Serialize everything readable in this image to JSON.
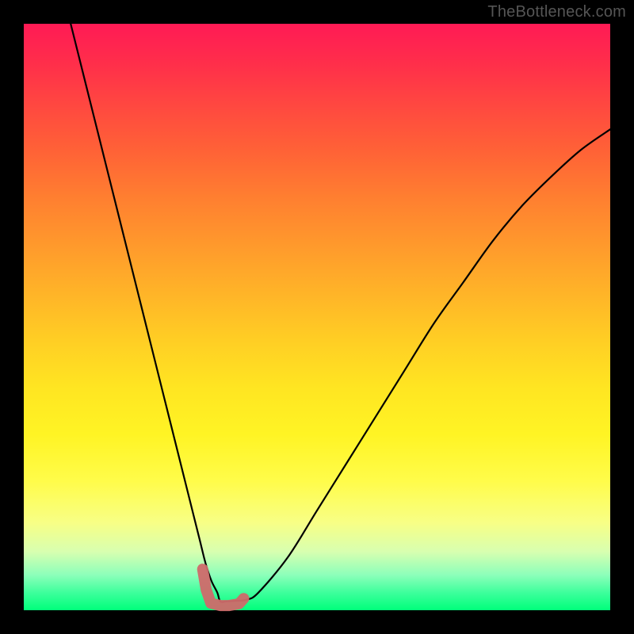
{
  "watermark": "TheBottleneck.com",
  "chart_data": {
    "type": "line",
    "title": "",
    "xlabel": "",
    "ylabel": "",
    "xlim": [
      0,
      100
    ],
    "ylim": [
      0,
      100
    ],
    "series": [
      {
        "name": "bottleneck-curve",
        "x": [
          8,
          10,
          12,
          14,
          16,
          18,
          20,
          22,
          24,
          26,
          28,
          30,
          31,
          32,
          33,
          33.5,
          34.5,
          36,
          38,
          40,
          45,
          50,
          55,
          60,
          65,
          70,
          75,
          80,
          85,
          90,
          95,
          100
        ],
        "values": [
          100,
          92,
          84,
          76,
          68,
          60,
          52,
          44,
          36,
          28,
          20,
          12,
          8,
          5,
          3,
          1.5,
          1.5,
          1.6,
          1.8,
          3,
          9,
          17,
          25,
          33,
          41,
          49,
          56,
          63,
          69,
          74,
          78.5,
          82
        ]
      }
    ],
    "annotations": [
      {
        "name": "operating-range-marker",
        "type": "segment-highlight",
        "x_range": [
          30.5,
          37.5
        ],
        "y_range": [
          0.8,
          7.0
        ],
        "color": "#d46a6a"
      }
    ],
    "background_gradient": {
      "type": "vertical",
      "stops": [
        {
          "pos": 0.0,
          "color": "#ff1a55"
        },
        {
          "pos": 0.3,
          "color": "#ff8030"
        },
        {
          "pos": 0.62,
          "color": "#ffe522"
        },
        {
          "pos": 0.85,
          "color": "#f8ff85"
        },
        {
          "pos": 1.0,
          "color": "#00ff7b"
        }
      ]
    }
  }
}
